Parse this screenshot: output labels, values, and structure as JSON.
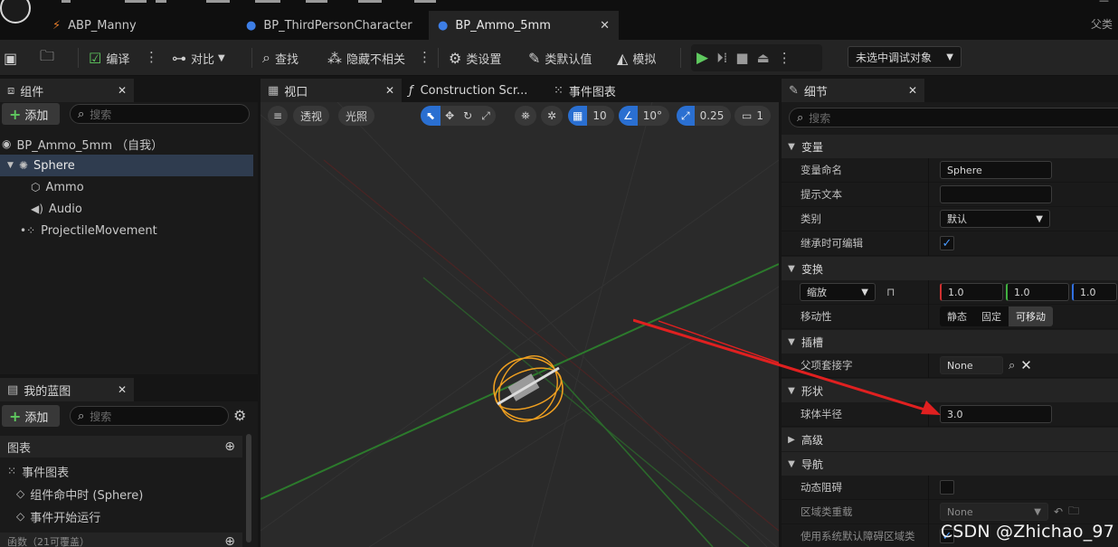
{
  "tabs": [
    {
      "label": "ABP_Manny"
    },
    {
      "label": "BP_ThirdPersonCharacter"
    },
    {
      "label": "BP_Ammo_5mm",
      "active": true
    }
  ],
  "parent_link": "父类",
  "toolbar": {
    "compile": "编译",
    "diff": "对比",
    "find": "查找",
    "hide_unrelated": "隐藏不相关",
    "class_settings": "类设置",
    "class_defaults": "类默认值",
    "simulate": "模拟",
    "debug_select": "未选中调试对象"
  },
  "components_panel": {
    "title": "组件",
    "add": "添加",
    "search_placeholder": "搜索",
    "items": [
      {
        "label": "BP_Ammo_5mm （自我）"
      },
      {
        "label": "Sphere",
        "selected": true
      },
      {
        "label": "Ammo"
      },
      {
        "label": "Audio"
      },
      {
        "label": "ProjectileMovement"
      }
    ]
  },
  "myblueprint_panel": {
    "title": "我的蓝图",
    "add": "添加",
    "search_placeholder": "搜索",
    "graphs_label": "图表",
    "event_graph": "事件图表",
    "events": [
      "组件命中时 (Sphere)",
      "事件开始运行"
    ],
    "functions_label": "函数（21可覆盖）"
  },
  "viewport_tabs": {
    "viewport": "视口",
    "construction": "Construction Scr...",
    "event_graph": "事件图表"
  },
  "viewport_toolbar": {
    "perspective": "透视",
    "lighting": "光照",
    "grid_snap": "10",
    "rot_snap": "10°",
    "scale_snap": "0.25",
    "camera_speed": "1"
  },
  "details": {
    "title": "细节",
    "search_placeholder": "搜索",
    "categories": {
      "variable": "变量",
      "transform": "变换",
      "sockets": "插槽",
      "shape": "形状",
      "advanced": "高级",
      "navigation": "导航"
    },
    "rows": {
      "var_name_label": "变量命名",
      "var_name_value": "Sphere",
      "tooltip_label": "提示文本",
      "category_label": "类别",
      "category_value": "默认",
      "editable_label": "继承时可编辑",
      "scale_label": "缩放",
      "scale_x": "1.0",
      "scale_y": "1.0",
      "scale_z": "1.0",
      "mobility_label": "移动性",
      "mobility_static": "静态",
      "mobility_stationary": "固定",
      "mobility_movable": "可移动",
      "parent_socket_label": "父项套接字",
      "parent_socket_value": "None",
      "sphere_radius_label": "球体半径",
      "sphere_radius_value": "3.0",
      "dynamic_obstacle_label": "动态阻碍",
      "area_class_label": "区域类重载",
      "area_class_value": "None",
      "use_default_label": "使用系统默认障碍区域类"
    }
  },
  "watermark": "CSDN @Zhichao_97",
  "colors": {
    "accent_blue": "#2a6fd1",
    "play_green": "#5fc95f",
    "selection_orange": "#f0a020",
    "arrow_red": "#e02020"
  }
}
